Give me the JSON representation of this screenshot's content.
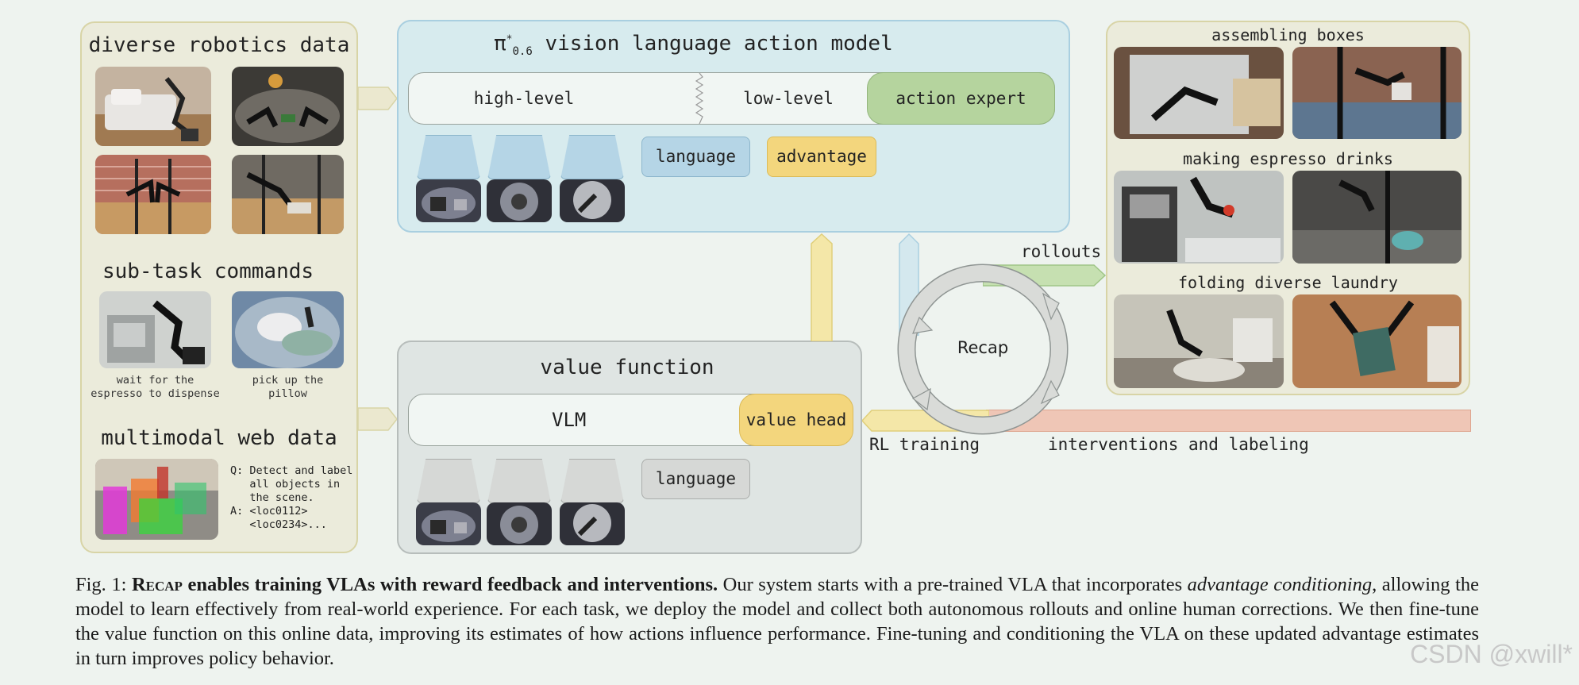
{
  "left_panel": {
    "heading_robotics": "diverse robotics data",
    "heading_subtask": "sub-task commands",
    "subtask_captions": [
      "wait for the espresso to dispense",
      "pick up the pillow"
    ],
    "heading_web": "multimodal web data",
    "qa_lines": [
      "Q: Detect and label",
      "   all objects in",
      "   the scene.",
      "A: <loc0112>",
      "   <loc0234>..."
    ]
  },
  "vla_panel": {
    "title_prefix": "π",
    "title_sup": "*",
    "title_sub": "0.6",
    "title_rest": "vision language action model",
    "high_level": "high-level",
    "low_level": "low-level",
    "action_expert": "action expert",
    "language": "language",
    "advantage": "advantage"
  },
  "value_panel": {
    "title": "value function",
    "vlm": "VLM",
    "value_head": "value head",
    "language": "language"
  },
  "cycle": {
    "label": "Recap",
    "rollouts": "rollouts",
    "rl_training": "RL training",
    "interventions": "interventions and labeling"
  },
  "right_panel": {
    "tasks": [
      "assembling boxes",
      "making espresso drinks",
      "folding diverse laundry"
    ]
  },
  "caption": {
    "fig": "Fig. 1: ",
    "name": "Recap",
    "bold_rest": " enables training VLAs with reward feedback and interventions.",
    "t1": " Our system starts with a pre-trained VLA that incorporates ",
    "italic1": "advantage conditioning",
    "t2": ", allowing the model to learn effectively from real-world experience. For each task, we deploy the model and collect both autonomous rollouts and online human corrections. We then fine-tune the value function on this online data, improving its estimates of how actions influence performance. Fine-tuning and conditioning the VLA on these updated advantage estimates in turn improves policy behavior."
  },
  "watermark": "CSDN @xwill*",
  "colors": {
    "left_panel_bg": "#ebebdb",
    "vla_panel_bg": "#d7ebee",
    "value_panel_bg": "#dfe5e3",
    "action_expert": "#b5d49e",
    "advantage": "#f3d67d",
    "language_blue": "#b5d5e6",
    "token_gray": "#d6d8d6",
    "interventions": "#efc6b6",
    "rollouts": "#c6e0b1"
  }
}
